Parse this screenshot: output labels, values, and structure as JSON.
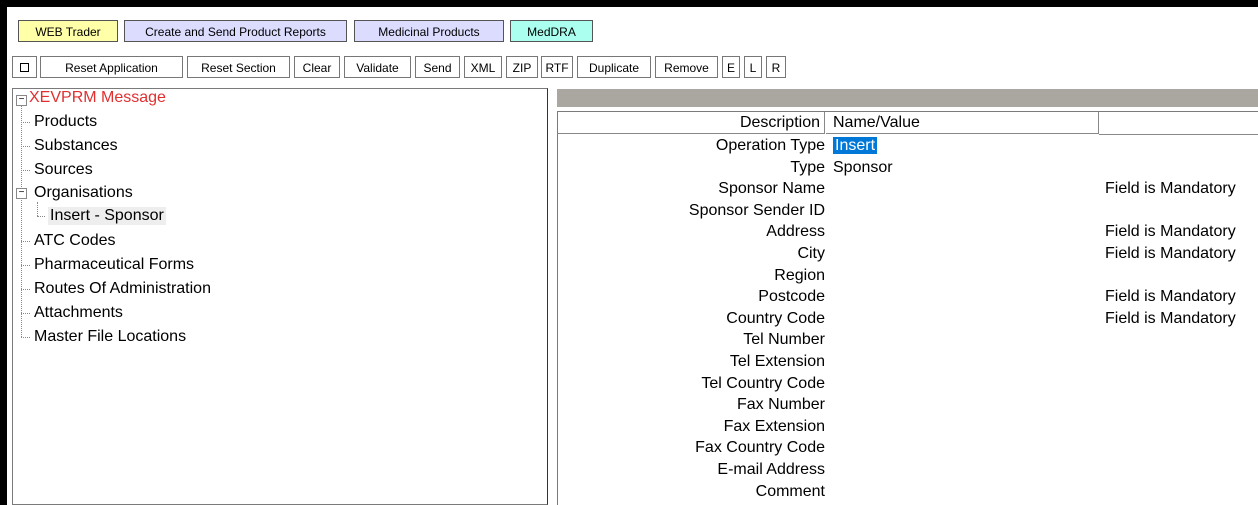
{
  "tabs": [
    {
      "label": "WEB Trader",
      "bg": "#ffffa8"
    },
    {
      "label": "Create and Send Product Reports",
      "bg": "#dcdcff"
    },
    {
      "label": "Medicinal Products",
      "bg": "#dcdcff"
    },
    {
      "label": "MedDRA",
      "bg": "#aaffee"
    }
  ],
  "toolbar": {
    "buttons": [
      "Reset Application",
      "Reset Section",
      "Clear",
      "Validate",
      "Send",
      "XML",
      "ZIP",
      "RTF",
      "Duplicate",
      "Remove",
      "E",
      "L",
      "R"
    ]
  },
  "tree": {
    "root": "XEVPRM Message",
    "items": [
      "Products",
      "Substances",
      "Sources",
      "Organisations",
      "ATC Codes",
      "Pharmaceutical Forms",
      "Routes Of Administration",
      "Attachments",
      "Master File Locations"
    ],
    "child": "Insert - Sponsor"
  },
  "grid": {
    "col_description": "Description",
    "col_value": "Name/Value",
    "rows": [
      {
        "desc": "Operation Type",
        "value": "Insert",
        "msg": ""
      },
      {
        "desc": "Type",
        "value": "Sponsor",
        "msg": ""
      },
      {
        "desc": "Sponsor Name",
        "value": "",
        "msg": "Field is Mandatory"
      },
      {
        "desc": "Sponsor Sender ID",
        "value": "",
        "msg": ""
      },
      {
        "desc": "Address",
        "value": "",
        "msg": "Field is Mandatory"
      },
      {
        "desc": "City",
        "value": "",
        "msg": "Field is Mandatory"
      },
      {
        "desc": "Region",
        "value": "",
        "msg": ""
      },
      {
        "desc": "Postcode",
        "value": "",
        "msg": "Field is Mandatory"
      },
      {
        "desc": "Country Code",
        "value": "",
        "msg": "Field is Mandatory"
      },
      {
        "desc": "Tel Number",
        "value": "",
        "msg": ""
      },
      {
        "desc": "Tel Extension",
        "value": "",
        "msg": ""
      },
      {
        "desc": "Tel Country Code",
        "value": "",
        "msg": ""
      },
      {
        "desc": "Fax Number",
        "value": "",
        "msg": ""
      },
      {
        "desc": "Fax Extension",
        "value": "",
        "msg": ""
      },
      {
        "desc": "Fax Country Code",
        "value": "",
        "msg": ""
      },
      {
        "desc": "E-mail Address",
        "value": "",
        "msg": ""
      },
      {
        "desc": "Comment",
        "value": "",
        "msg": ""
      }
    ]
  }
}
